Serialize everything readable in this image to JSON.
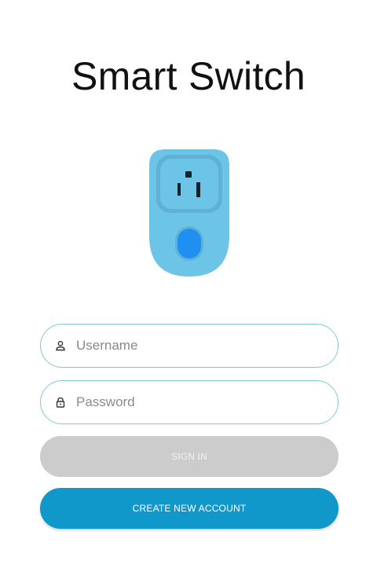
{
  "app": {
    "title": "Smart Switch"
  },
  "login": {
    "username_placeholder": "Username",
    "username_value": "",
    "password_placeholder": "Password",
    "password_value": "",
    "signin_label": "SIGN IN",
    "create_label": "CREATE NEW ACCOUNT"
  },
  "icons": {
    "device": "smart-plug-icon",
    "username": "person-icon",
    "password": "lock-icon"
  },
  "colors": {
    "field_border": "#82c7d8",
    "signin_disabled_bg": "#cccccc",
    "create_bg": "#0f98c9",
    "plug_body": "#6cc4e6",
    "plug_button": "#1f8ff2"
  },
  "state": {
    "signin_enabled": false
  }
}
